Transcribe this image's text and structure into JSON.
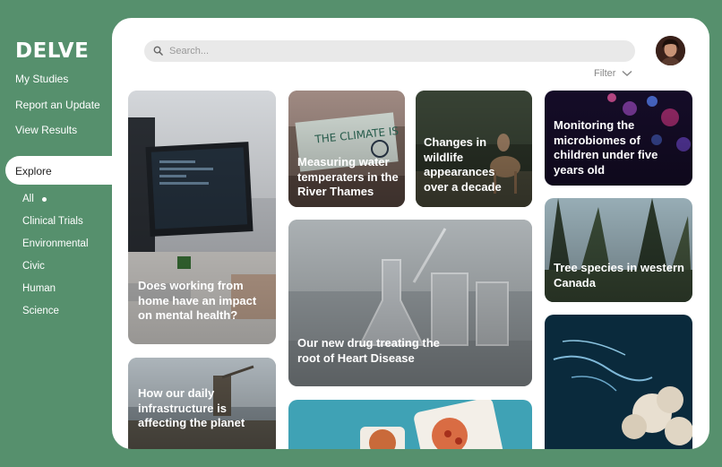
{
  "brand": {
    "logo": "DELVE"
  },
  "nav": {
    "my_studies": "My Studies",
    "report_update": "Report an Update",
    "view_results": "View Results",
    "explore": "Explore"
  },
  "categories": [
    "All",
    "Clinical Trials",
    "Environmental",
    "Civic",
    "Human",
    "Science"
  ],
  "search": {
    "placeholder": "Search..."
  },
  "filter": {
    "label": "Filter"
  },
  "cards": [
    {
      "title": "Does working from home have an impact on mental health?"
    },
    {
      "title": "How our daily infrastructure is affecting the planet"
    },
    {
      "title": "Measuring water temperaters in the River Thames"
    },
    {
      "title": "Our new drug treating the root of Heart Disease"
    },
    {
      "title": "Changes in wildlife appearances over a decade"
    },
    {
      "title": "Monitoring the microbiomes of children under five years old"
    },
    {
      "title": "Tree species in western Canada"
    }
  ],
  "colors": {
    "background": "#56906d",
    "panel": "#ffffff"
  }
}
